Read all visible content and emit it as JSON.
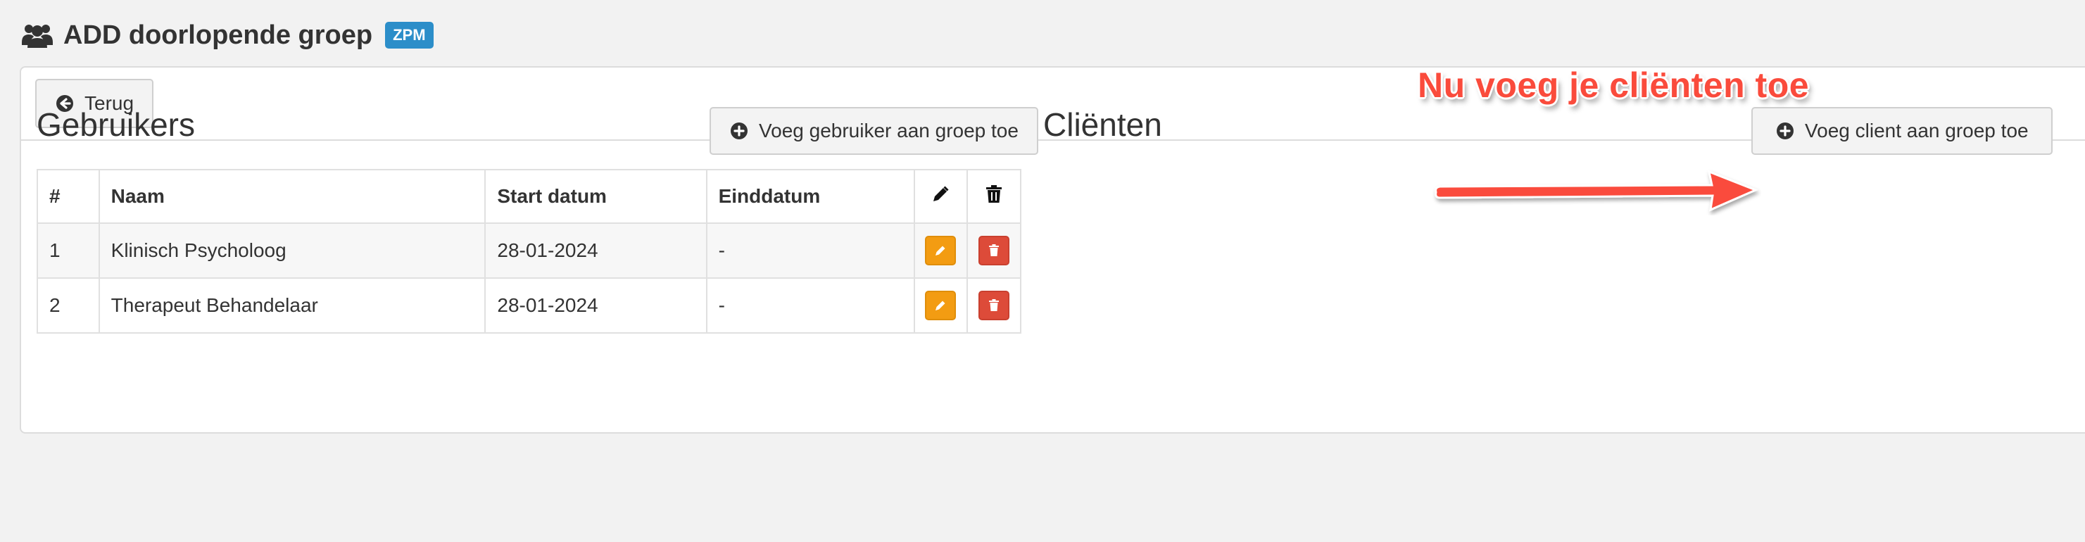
{
  "header": {
    "title": "ADD doorlopende groep",
    "badge": "ZPM"
  },
  "toolbar": {
    "back_label": "Terug"
  },
  "users": {
    "title": "Gebruikers",
    "add_label": "Voeg gebruiker aan groep toe",
    "columns": [
      "#",
      "Naam",
      "Start datum",
      "Einddatum"
    ],
    "rows": [
      {
        "num": "1",
        "name": "Klinisch Psycholoog",
        "start": "28-01-2024",
        "end": "-"
      },
      {
        "num": "2",
        "name": "Therapeut Behandelaar",
        "start": "28-01-2024",
        "end": "-"
      }
    ]
  },
  "clients": {
    "title": "Cliënten",
    "add_label": "Voeg client aan groep toe"
  },
  "annotation": {
    "text": "Nu voeg je cliënten toe"
  },
  "colors": {
    "badge": "#2c8ec9",
    "edit": "#f39c12",
    "delete": "#dd4b39",
    "annotation": "#fa4b3c"
  }
}
